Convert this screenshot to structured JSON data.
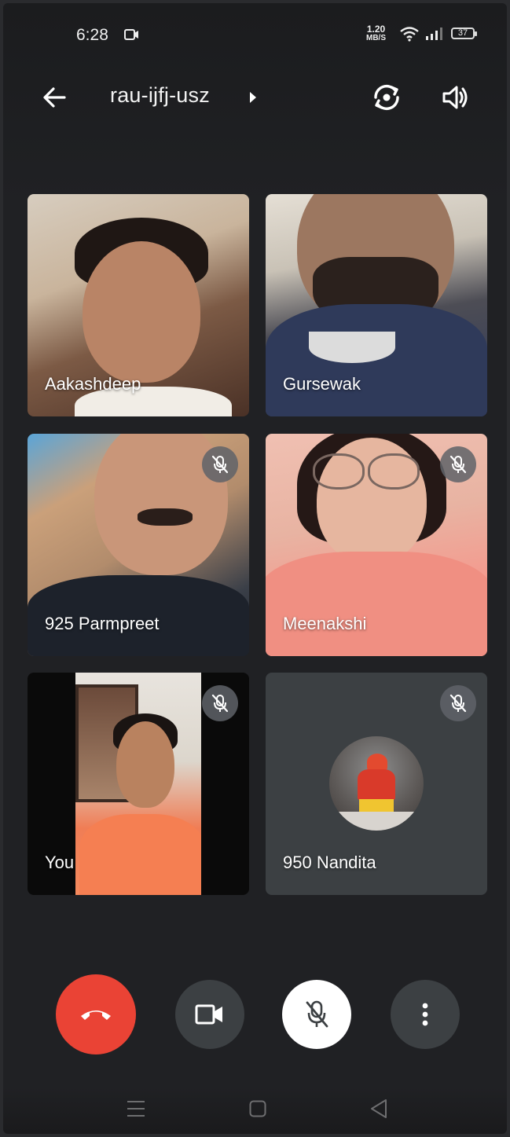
{
  "status_bar": {
    "time": "6:28",
    "net_speed_value": "1.20",
    "net_speed_unit": "MB/S",
    "battery": "37"
  },
  "top_bar": {
    "meeting_code": "rau-ijfj-usz",
    "back_icon": "arrow-left",
    "flip_camera_icon": "camera-switch",
    "audio_icon": "speaker"
  },
  "participants": [
    {
      "name": "Aakashdeep",
      "muted": false
    },
    {
      "name": "Gursewak",
      "muted": false
    },
    {
      "name": "925 Parmpreet",
      "muted": true
    },
    {
      "name": "Meenakshi",
      "muted": true
    },
    {
      "name": "You",
      "muted": true
    },
    {
      "name": "950 Nandita",
      "muted": true
    }
  ],
  "controls": {
    "end_call_icon": "phone-hangup",
    "video_icon": "videocam",
    "mic_icon": "mic-off",
    "more_icon": "more-vertical",
    "colors": {
      "end_call": "#ea4335",
      "button": "#3c4043",
      "mic_active": "#ffffff"
    }
  },
  "nav_bar": {
    "menu_icon": "menu",
    "home_icon": "square",
    "back_icon": "triangle-back"
  }
}
